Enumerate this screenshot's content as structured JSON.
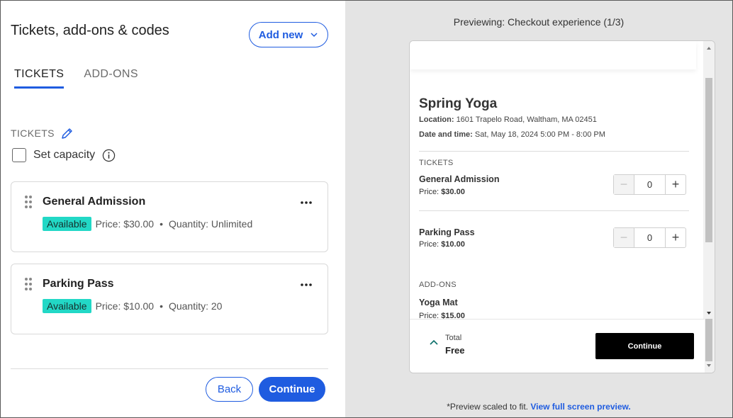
{
  "left": {
    "title": "Tickets, add-ons & codes",
    "add_new_label": "Add new",
    "tabs": [
      {
        "label": "TICKETS",
        "active": true
      },
      {
        "label": "ADD-ONS",
        "active": false
      }
    ],
    "section_label": "TICKETS",
    "capacity_label": "Set capacity",
    "tickets": [
      {
        "name": "General Admission",
        "status": "Available",
        "price": "Price: $30.00",
        "quantity": "Quantity: Unlimited"
      },
      {
        "name": "Parking Pass",
        "status": "Available",
        "price": "Price: $10.00",
        "quantity": "Quantity: 20"
      }
    ],
    "separator": "•",
    "back_label": "Back",
    "continue_label": "Continue"
  },
  "preview": {
    "label": "Previewing: Checkout experience (1/3)",
    "event_title": "Spring Yoga",
    "location_label": "Location:",
    "location_value": "1601 Trapelo Road, Waltham, MA 02451",
    "datetime_label": "Date and time:",
    "datetime_value": "Sat, May 18, 2024 5:00 PM - 8:00 PM",
    "tickets_section": "TICKETS",
    "price_label": "Price:",
    "items": [
      {
        "name": "General Admission",
        "price": "$30.00",
        "qty": "0"
      },
      {
        "name": "Parking Pass",
        "price": "$10.00",
        "qty": "0"
      }
    ],
    "addons_section": "ADD-ONS",
    "addon": {
      "name": "Yoga Mat",
      "price": "$15.00"
    },
    "minus": "−",
    "plus": "+",
    "total_label": "Total",
    "total_value": "Free",
    "continue_label": "Continue",
    "note_text": "*Preview scaled to fit.",
    "note_link": "View full screen preview."
  },
  "colors": {
    "accent": "#1f5ce0",
    "badge": "#22d8c6",
    "preview_bg": "#e4e4e4"
  }
}
